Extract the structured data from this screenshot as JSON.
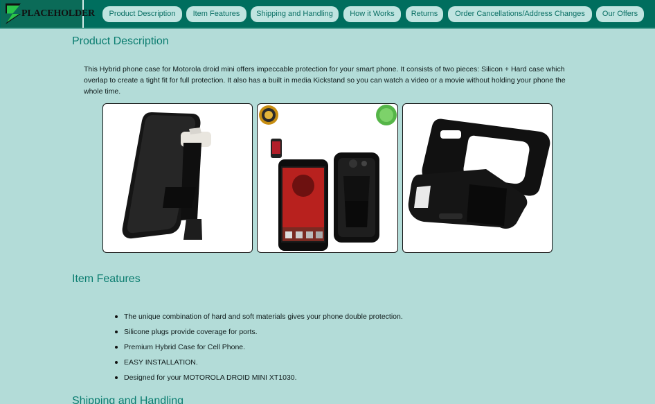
{
  "brand": {
    "logo_text": "PLACEHOLDER"
  },
  "nav": [
    {
      "label": "Product Description"
    },
    {
      "label": "Item Features"
    },
    {
      "label": "Shipping and Handling"
    },
    {
      "label": "How it Works"
    },
    {
      "label": "Returns"
    },
    {
      "label": "Order Cancellations/Address Changes"
    },
    {
      "label": "Our Offers"
    }
  ],
  "product": {
    "title": "Product Description",
    "description": "This Hybrid phone case for Motorola droid mini offers impeccable protection for your smart phone. It consists of two pieces: Silicon + Hard case which overlap to create a tight fit for full protection. It also has a built in media Kickstand so you can watch a video or a movie without holding your phone the whole time."
  },
  "features": {
    "title": "Item Features",
    "items": [
      "The unique combination of hard and soft materials gives your phone double protection.",
      "Silicone plugs provide coverage for ports.",
      "Premium Hybrid Case for Cell Phone.",
      "EASY INSTALLATION.",
      "Designed for your MOTOROLA DROID MINI XT1030."
    ]
  },
  "shipping": {
    "title": "Shipping and Handling"
  },
  "colors": {
    "header_bg": "#006e5e",
    "page_bg": "#b3dcd8",
    "nav_pill_bg": "#bfe4e0",
    "accent": "#0b7d70"
  }
}
